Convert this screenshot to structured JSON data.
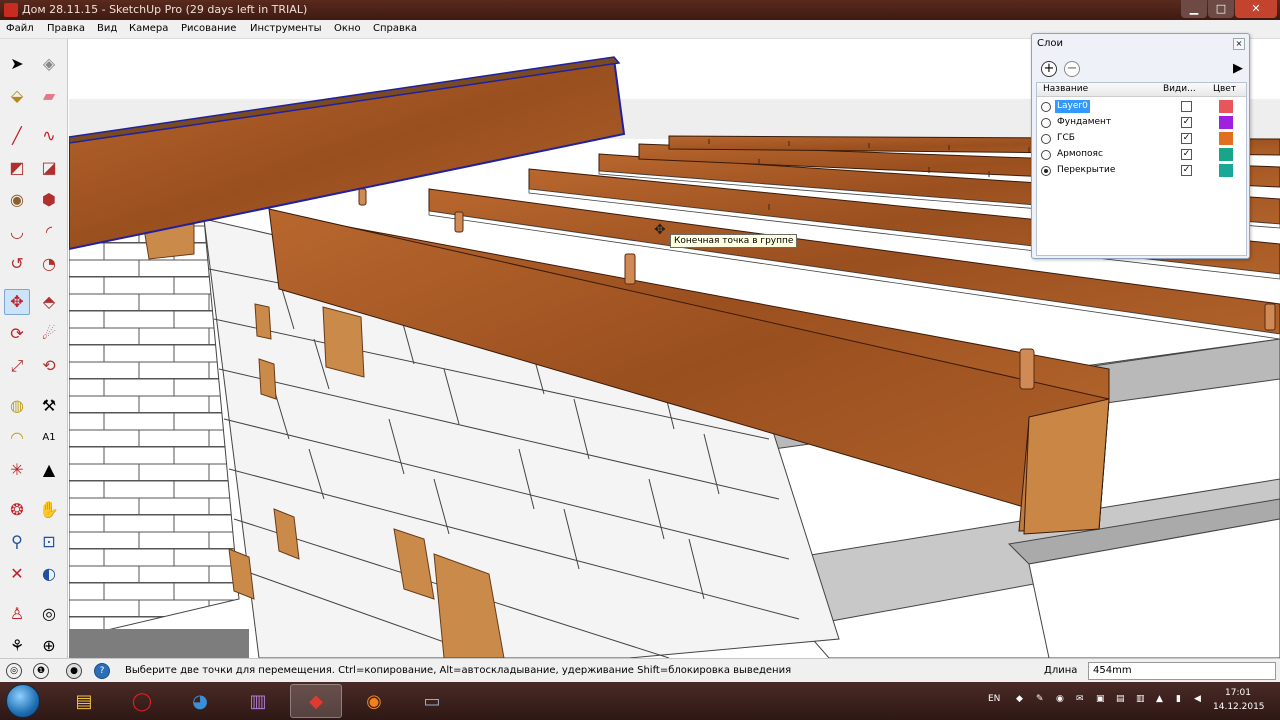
{
  "window": {
    "title": "Дом 28.11.15 - SketchUp Pro (29 days left in TRIAL)",
    "controls": {
      "minimize": "▁",
      "maximize": "□",
      "close": "✕"
    }
  },
  "menu": {
    "items": [
      "Файл",
      "Правка",
      "Вид",
      "Камера",
      "Рисование",
      "Инструменты",
      "Окно",
      "Справка"
    ]
  },
  "toolbar": {
    "icons": [
      "select-arrow-icon",
      "make-component-icon",
      "paint-bucket-icon",
      "eraser-icon",
      "pencil-line-icon",
      "freehand-icon",
      "rectangle-icon",
      "rotated-rectangle-icon",
      "circle-icon",
      "polygon-icon",
      "arc-icon",
      "arc-2pt-icon",
      "arc-3pt-icon",
      "pie-icon",
      "move-icon",
      "push-pull-icon",
      "rotate-icon",
      "follow-me-icon",
      "scale-icon",
      "offset-icon",
      "tape-measure-icon",
      "dimension-icon",
      "protractor-icon",
      "text-icon",
      "axes-icon",
      "3d-text-icon",
      "orbit-icon",
      "pan-icon",
      "zoom-icon",
      "zoom-window-icon",
      "zoom-extents-icon",
      "previous-view-icon",
      "position-camera-icon",
      "look-around-icon",
      "walk-icon",
      "section-plane-icon"
    ],
    "selected": "move-icon"
  },
  "viewport": {
    "tooltip": "Конечная точка в группе"
  },
  "layers_panel": {
    "title": "Слои",
    "close": "×",
    "add_button": "+",
    "remove_button": "−",
    "details_button": "▶",
    "header": {
      "name": "Название",
      "visible": "Види...",
      "color": "Цвет"
    },
    "layers": [
      {
        "name": "Layer0",
        "active": false,
        "visible": false,
        "color": "#e8555a",
        "selected": true
      },
      {
        "name": "Фундамент",
        "active": false,
        "visible": true,
        "color": "#a020e0",
        "selected": false
      },
      {
        "name": "ГСБ",
        "active": false,
        "visible": true,
        "color": "#e07020",
        "selected": false
      },
      {
        "name": "Армопояс",
        "active": false,
        "visible": true,
        "color": "#19a58a",
        "selected": false
      },
      {
        "name": "Перекрытие",
        "active": true,
        "visible": true,
        "color": "#1aa896",
        "selected": false
      }
    ]
  },
  "statusbar": {
    "message": "Выберите две точки для перемещения. Ctrl=копирование, Alt=автоскладывание, удерживание Shift=блокировка выведения",
    "measure_label": "Длина",
    "measure_value": "454mm"
  },
  "taskbar": {
    "language": "EN",
    "time": "17:01",
    "date": "14.12.2015",
    "apps": [
      "file-explorer-icon",
      "opera-icon",
      "chat-app-icon",
      "winrar-icon",
      "sketchup-icon",
      "firefox-icon",
      "window-app-icon"
    ],
    "active_app": "sketchup-icon"
  }
}
